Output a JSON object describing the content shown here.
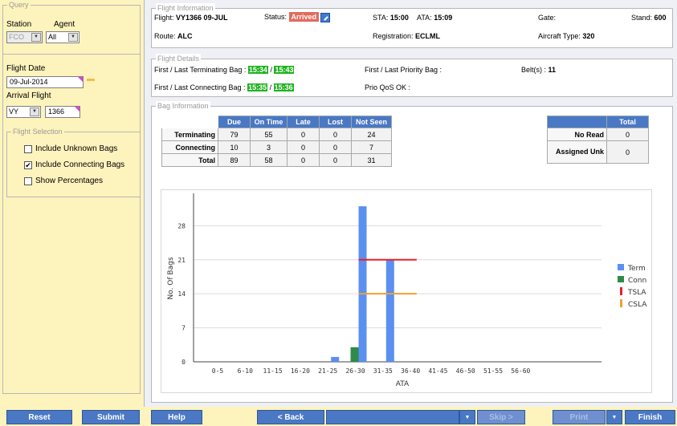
{
  "query": {
    "legend": "Query",
    "station_label": "Station",
    "agent_label": "Agent",
    "station_value": "FCO",
    "agent_value": "All",
    "flight_date_label": "Flight Date",
    "flight_date_value": "09-Jul-2014",
    "arrival_flight_label": "Arrival Flight",
    "airline_value": "VY",
    "flight_number_value": "1366"
  },
  "flight_selection": {
    "legend": "Flight Selection",
    "options": [
      {
        "label": "Include Unknown Bags",
        "checked": false
      },
      {
        "label": "Include Connecting Bags",
        "checked": true
      },
      {
        "label": "Show Percentages",
        "checked": false
      }
    ]
  },
  "flight_info": {
    "legend": "Flight Information",
    "flight_label": "Flight:",
    "flight_value": "VY1366 09-JUL",
    "status_label": "Status:",
    "status_value": "Arrived",
    "sta_label": "STA:",
    "sta_value": "15:00",
    "ata_label": "ATA:",
    "ata_value": "15:09",
    "gate_label": "Gate:",
    "stand_label": "Stand:",
    "stand_value": "600",
    "route_label": "Route:",
    "route_value": "ALC",
    "registration_label": "Registration:",
    "registration_value": "ECLML",
    "aircraft_label": "Aircraft Type:",
    "aircraft_value": "320"
  },
  "flight_details": {
    "legend": "Flight Details",
    "term_label": "First / Last Terminating Bag :",
    "term_first": "15:34",
    "term_last": "15:43",
    "conn_label": "First / Last Connecting Bag :",
    "conn_first": "15:35",
    "conn_last": "15:36",
    "priority_label": "First / Last Priority Bag :",
    "prio_qos_label": "Prio QoS OK :",
    "belts_label": "Belt(s) :",
    "belts_value": "11"
  },
  "bag_info": {
    "legend": "Bag Information",
    "columns": [
      "Due",
      "On Time",
      "Late",
      "Lost",
      "Not Seen"
    ],
    "rows": [
      {
        "label": "Terminating",
        "values": [
          "79",
          "55",
          "0",
          "0",
          "24"
        ]
      },
      {
        "label": "Connecting",
        "values": [
          "10",
          "3",
          "0",
          "0",
          "7"
        ]
      },
      {
        "label": "Total",
        "values": [
          "89",
          "58",
          "0",
          "0",
          "31"
        ]
      }
    ],
    "side_header": "Total",
    "side_rows": [
      {
        "label": "No Read",
        "value": "0"
      },
      {
        "label": "Assigned Unk",
        "value": "0"
      }
    ]
  },
  "chart_data": {
    "type": "bar",
    "categories": [
      "0-5",
      "6-10",
      "11-15",
      "16-20",
      "21-25",
      "26-30",
      "31-35",
      "36-40",
      "41-45",
      "46-50",
      "51-55",
      "56-60"
    ],
    "series": [
      {
        "name": "Term",
        "color": "#5b8ff0",
        "values": [
          0,
          0,
          0,
          0,
          1,
          32,
          21,
          0,
          0,
          0,
          0,
          0
        ]
      },
      {
        "name": "Conn",
        "color": "#2e8b4a",
        "values": [
          0,
          0,
          0,
          0,
          0,
          3,
          0,
          0,
          0,
          0,
          0,
          0
        ]
      }
    ],
    "sla_lines": [
      {
        "name": "TSLA",
        "color": "#e8212a",
        "value": 21,
        "from_category": "26-30",
        "to_category": "31-35"
      },
      {
        "name": "CSLA",
        "color": "#f0a030",
        "value": 14,
        "from_category": "26-30",
        "to_category": "31-35"
      }
    ],
    "xlabel": "ATA",
    "ylabel": "No. Of Bags",
    "yticks": [
      0,
      7,
      14,
      21,
      28
    ],
    "ylim": [
      0,
      34
    ],
    "legend_position": "right",
    "grid": "horizontal"
  },
  "buttons": {
    "reset": "Reset",
    "submit": "Submit",
    "help": "Help",
    "back": "< Back",
    "skip": "Skip >",
    "print": "Print",
    "finish": "Finish"
  },
  "colors": {
    "panel_bg": "#fdf3bd",
    "button_blue": "#4a78c4",
    "status_red": "#e36a5b",
    "highlight_green": "#1eb21e"
  }
}
